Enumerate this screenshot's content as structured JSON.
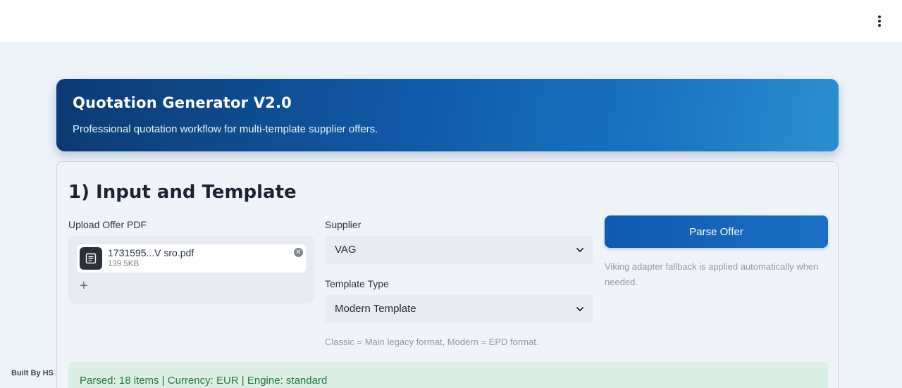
{
  "header": {
    "menu_icon": "kebab-menu-icon"
  },
  "hero": {
    "title": "Quotation Generator V2.0",
    "subtitle": "Professional quotation workflow for multi-template supplier offers."
  },
  "section": {
    "title": "1) Input and Template",
    "upload": {
      "label": "Upload Offer PDF",
      "file_name": "1731595...V sro.pdf",
      "file_size": "139.5KB",
      "add_icon": "plus-icon"
    },
    "supplier": {
      "label": "Supplier",
      "value": "VAG"
    },
    "template": {
      "label": "Template Type",
      "value": "Modern Template",
      "help": "Classic = Main legacy format, Modern = EPD format."
    },
    "parse": {
      "button_label": "Parse Offer",
      "help": "Viking adapter fallback is applied automatically when needed."
    },
    "status": {
      "message": "Parsed: 18 items | Currency: EUR | Engine: standard"
    }
  },
  "footer": {
    "built_by": "Built By HS"
  },
  "colors": {
    "accent": "#105aa8",
    "success_bg": "#dcefe5",
    "success_text": "#207a3c"
  }
}
